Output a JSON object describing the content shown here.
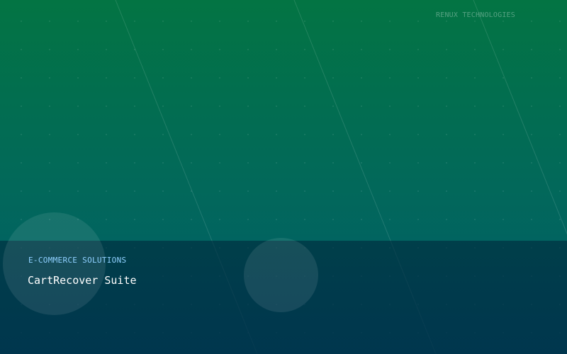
{
  "brand": {
    "company": "RENUX TECHNOLOGIES"
  },
  "hero": {
    "category": "E-COMMERCE SOLUTIONS",
    "product_name": "CartRecover Suite"
  },
  "colors": {
    "gradient_top": "#037443",
    "gradient_bottom": "#005c6c",
    "panel": "#00293c",
    "category_text": "#8fd0ff",
    "title_text": "#ffffff"
  }
}
